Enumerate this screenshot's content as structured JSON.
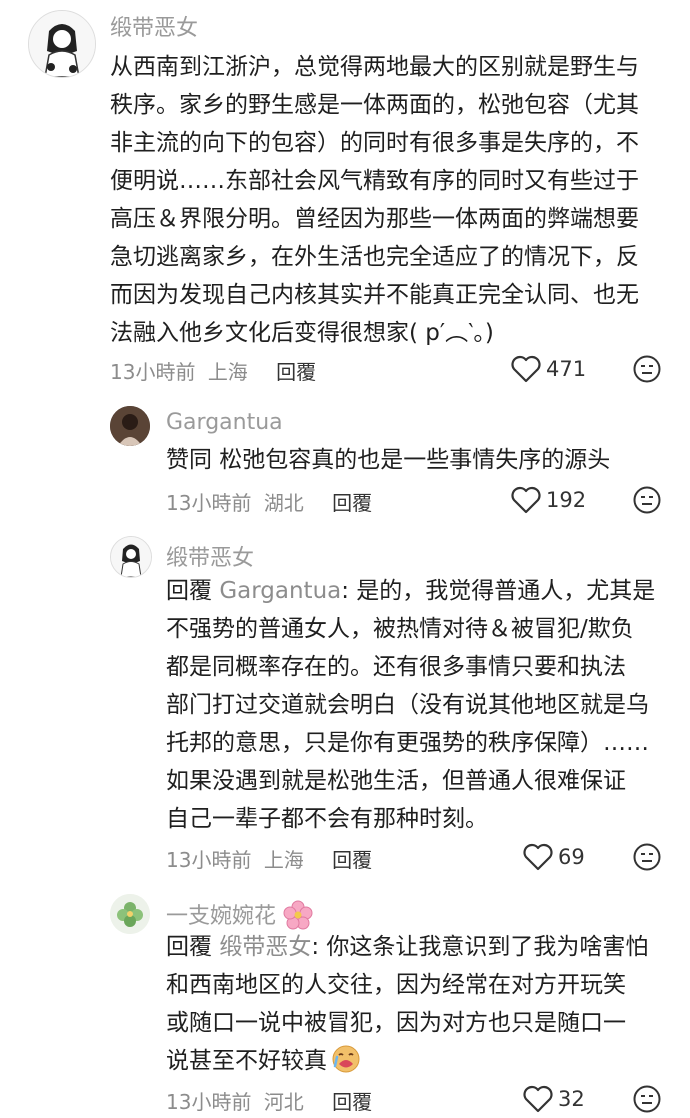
{
  "comments": [
    {
      "username": "缎带恶女",
      "lines": [
        "从西南到江浙沪，总觉得两地最大的区别就是野生与",
        "秩序。家乡的野生感是一体两面的，松弛包容（尤其",
        "非主流的向下的包容）的同时有很多事是失序的，不",
        "便明说……东部社会风气精致有序的同时又有些过于",
        "高压＆界限分明。曾经因为那些一体两面的弊端想要",
        "急切逃离家乡，在外生活也完全适应了的情况下，反",
        "而因为发现自己内核其实并不能真正完全认同、也无",
        "法融入他乡文化后变得很想家(  p′︵‵。)"
      ],
      "time": "13小時前",
      "location": "上海",
      "reply_label": "回覆",
      "likes": "471"
    },
    {
      "username": "Gargantua",
      "lines": [
        "赞同 松弛包容真的也是一些事情失序的源头"
      ],
      "time": "13小時前",
      "location": "湖北",
      "reply_label": "回覆",
      "likes": "192"
    },
    {
      "username": "缎带恶女",
      "reply_prefix": "回覆",
      "reply_to": "Gargantua",
      "first_line_rest": ": 是的，我觉得普通人，尤其是",
      "lines": [
        "不强势的普通女人，被热情对待＆被冒犯/欺负",
        "都是同概率存在的。还有很多事情只要和执法",
        "部门打过交道就会明白（没有说其他地区就是乌",
        "托邦的意思，只是你有更强势的秩序保障）……",
        "如果没遇到就是松弛生活，但普通人很难保证",
        "自己一辈子都不会有那种时刻。"
      ],
      "time": "13小時前",
      "location": "上海",
      "reply_label": "回覆",
      "likes": "69"
    },
    {
      "username": "一支婉婉花",
      "reply_prefix": "回覆",
      "reply_to": "缎带恶女",
      "first_line_rest": ": 你这条让我意识到了我为啥害怕",
      "lines": [
        "和西南地区的人交往，因为经常在对方开玩笑",
        "或随口一说中被冒犯，因为对方也只是随口一",
        "说甚至不好较真"
      ],
      "time": "13小時前",
      "location": "河北",
      "reply_label": "回覆",
      "likes": "32"
    }
  ]
}
